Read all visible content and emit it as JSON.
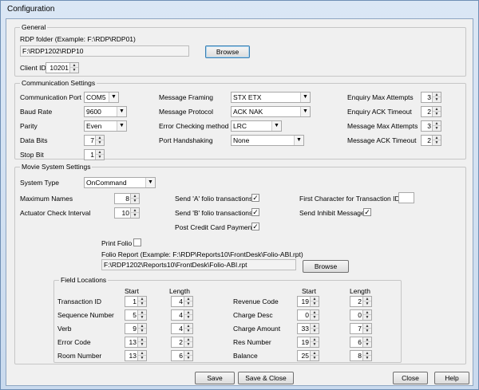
{
  "window": {
    "title": "Configuration"
  },
  "general": {
    "legend": "General",
    "rdp_folder_label": "RDP folder (Example: F:\\RDP\\RDP01)",
    "rdp_folder_value": "F:\\RDP1202\\RDP10",
    "browse_label": "Browse",
    "client_id_label": "Client ID",
    "client_id_value": "10201"
  },
  "comm": {
    "legend": "Communication Settings",
    "port_label": "Communication Port",
    "port_value": "COM5",
    "baud_label": "Baud Rate",
    "baud_value": "9600",
    "parity_label": "Parity",
    "parity_value": "Even",
    "data_bits_label": "Data Bits",
    "data_bits_value": "7",
    "stop_bit_label": "Stop Bit",
    "stop_bit_value": "1",
    "framing_label": "Message Framing",
    "framing_value": "STX ETX",
    "protocol_label": "Message Protocol",
    "protocol_value": "ACK NAK",
    "error_label": "Error Checking method",
    "error_value": "LRC",
    "handshake_label": "Port Handshaking",
    "handshake_value": "None",
    "enq_max_label": "Enquiry Max Attempts",
    "enq_max_value": "3",
    "enq_ack_label": "Enquiry ACK Timeout",
    "enq_ack_value": "2",
    "msg_max_label": "Message Max Attempts",
    "msg_max_value": "3",
    "msg_ack_label": "Message ACK Timeout",
    "msg_ack_value": "2"
  },
  "movie": {
    "legend": "Movie System Settings",
    "system_type_label": "System Type",
    "system_type_value": "OnCommand",
    "max_names_label": "Maximum Names",
    "max_names_value": "8",
    "actuator_label": "Actuator Check Interval",
    "actuator_value": "10",
    "send_a_label": "Send 'A' folio transactions",
    "send_a_checked": true,
    "send_b_label": "Send 'B' folio transactions",
    "send_b_checked": true,
    "post_cc_label": "Post Credit Card Payment",
    "post_cc_checked": true,
    "first_char_label": "First Character for Transaction ID",
    "first_char_value": "",
    "send_inhibit_label": "Send Inhibit Message",
    "send_inhibit_checked": true,
    "print_folio_label": "Print Folio",
    "print_folio_checked": false,
    "folio_report_label": "Folio Report (Example: F:\\RDP\\Reports10\\FrontDesk\\Folio-ABI.rpt)",
    "folio_report_value": "F:\\RDP1202\\Reports10\\FrontDesk\\Folio-ABI.rpt",
    "browse_label": "Browse"
  },
  "fields": {
    "legend": "Field Locations",
    "start_header": "Start",
    "length_header": "Length",
    "left": [
      {
        "label": "Transaction ID",
        "start": "1",
        "length": "4"
      },
      {
        "label": "Sequence Number",
        "start": "5",
        "length": "4"
      },
      {
        "label": "Verb",
        "start": "9",
        "length": "4"
      },
      {
        "label": "Error Code",
        "start": "13",
        "length": "2"
      },
      {
        "label": "Room Number",
        "start": "13",
        "length": "6"
      }
    ],
    "right": [
      {
        "label": "Revenue Code",
        "start": "19",
        "length": "2"
      },
      {
        "label": "Charge Desc",
        "start": "0",
        "length": "0"
      },
      {
        "label": "Charge Amount",
        "start": "33",
        "length": "7"
      },
      {
        "label": "Res Number",
        "start": "19",
        "length": "6"
      },
      {
        "label": "Balance",
        "start": "25",
        "length": "8"
      }
    ]
  },
  "footer": {
    "save_label": "Save",
    "save_close_label": "Save & Close",
    "close_label": "Close",
    "help_label": "Help"
  },
  "icons": {
    "spin": "spin-arrows",
    "dropdown": "chevron-down-icon",
    "check": "check-icon"
  }
}
